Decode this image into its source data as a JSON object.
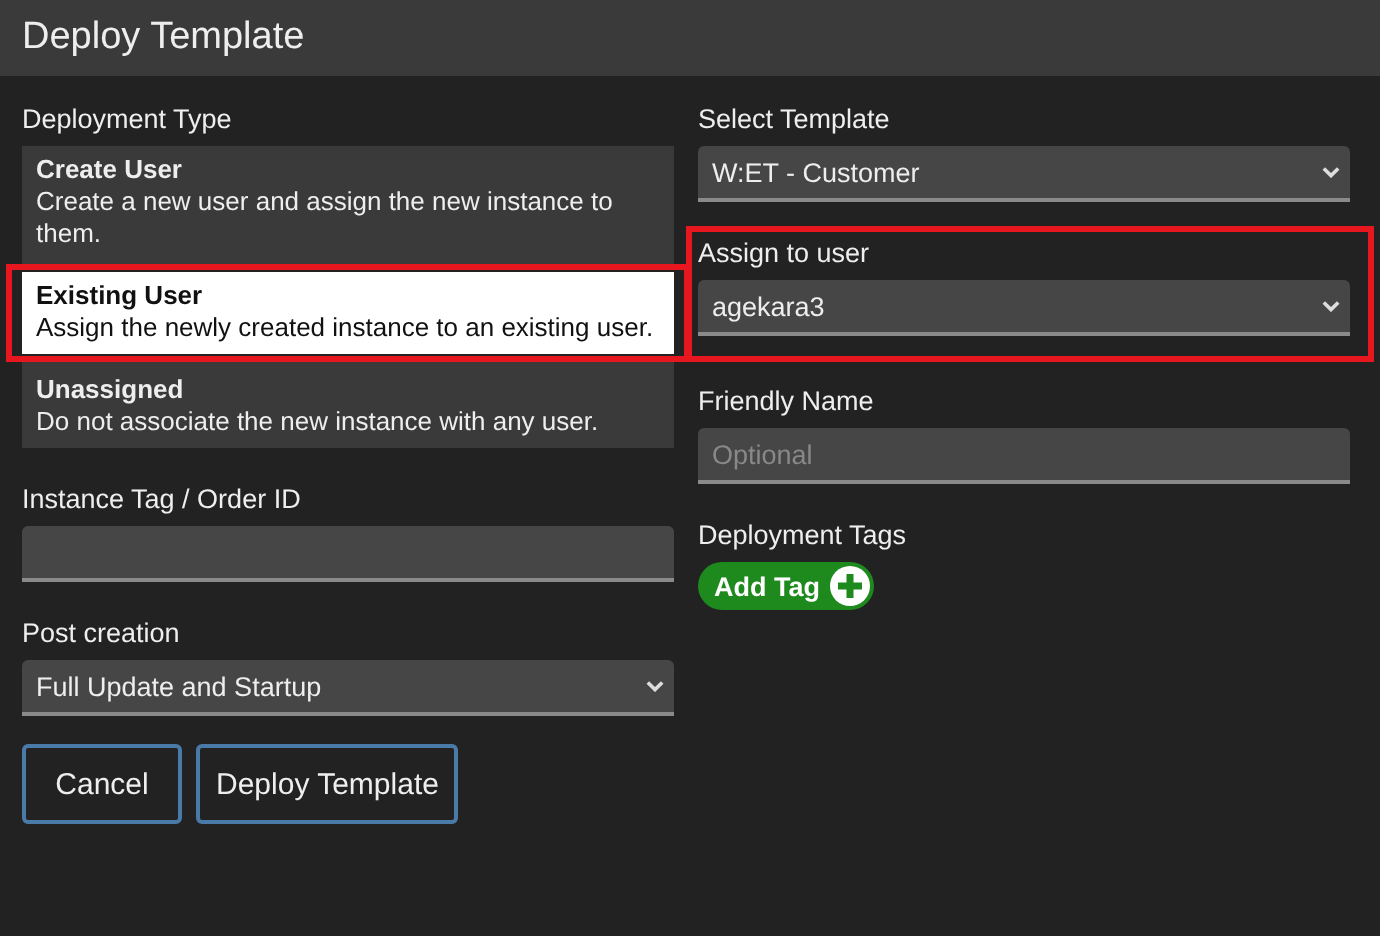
{
  "window": {
    "title": "Deploy Template"
  },
  "deployment_type": {
    "label": "Deployment Type",
    "options": [
      {
        "title": "Create User",
        "description": "Create a new user and assign the new instance to them.",
        "selected": false,
        "highlighted": false
      },
      {
        "title": "Existing User",
        "description": "Assign the newly created instance to an existing user.",
        "selected": true,
        "highlighted": true
      },
      {
        "title": "Unassigned",
        "description": "Do not associate the new instance with any user.",
        "selected": false,
        "highlighted": false
      }
    ]
  },
  "instance_tag": {
    "label": "Instance Tag / Order ID"
  },
  "post_creation": {
    "label": "Post creation",
    "value": "Full Update and Startup"
  },
  "select_template": {
    "label": "Select Template",
    "value": "W:ET - Customer"
  },
  "assign_to_user": {
    "label": "Assign to user",
    "value": "agekara3",
    "highlighted": true
  },
  "friendly_name": {
    "label": "Friendly Name",
    "placeholder": "Optional"
  },
  "deployment_tags": {
    "label": "Deployment Tags",
    "add_button": "Add Tag"
  },
  "buttons": [
    "Cancel",
    "Deploy Template"
  ]
}
